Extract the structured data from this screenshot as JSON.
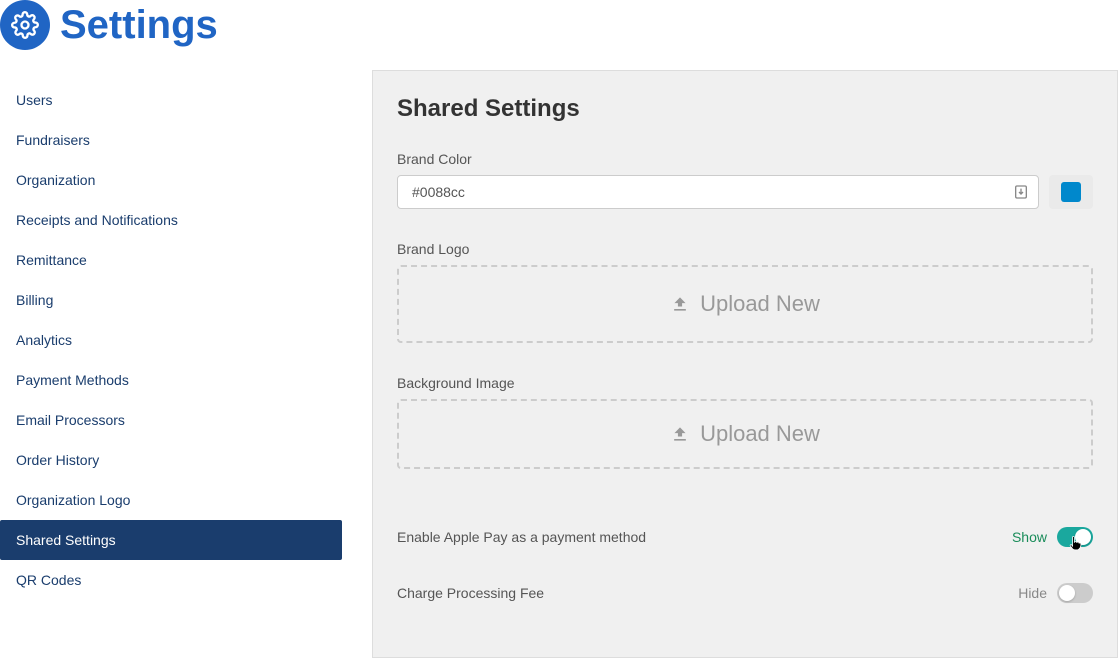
{
  "header": {
    "title": "Settings"
  },
  "sidebar": {
    "items": [
      {
        "label": "Users",
        "active": false
      },
      {
        "label": "Fundraisers",
        "active": false
      },
      {
        "label": "Organization",
        "active": false
      },
      {
        "label": "Receipts and Notifications",
        "active": false
      },
      {
        "label": "Remittance",
        "active": false
      },
      {
        "label": "Billing",
        "active": false
      },
      {
        "label": "Analytics",
        "active": false
      },
      {
        "label": "Payment Methods",
        "active": false
      },
      {
        "label": "Email Processors",
        "active": false
      },
      {
        "label": "Order History",
        "active": false
      },
      {
        "label": "Organization Logo",
        "active": false
      },
      {
        "label": "Shared Settings",
        "active": true
      },
      {
        "label": "QR Codes",
        "active": false
      }
    ]
  },
  "panel": {
    "title": "Shared Settings",
    "brand_color": {
      "label": "Brand Color",
      "value": "#0088cc",
      "swatch": "#0088cc"
    },
    "brand_logo": {
      "label": "Brand Logo",
      "upload_text": "Upload New"
    },
    "background_image": {
      "label": "Background Image",
      "upload_text": "Upload New"
    },
    "apple_pay": {
      "label": "Enable Apple Pay as a payment method",
      "state_text": "Show",
      "enabled": true
    },
    "processing_fee": {
      "label": "Charge Processing Fee",
      "state_text": "Hide",
      "enabled": false
    }
  }
}
